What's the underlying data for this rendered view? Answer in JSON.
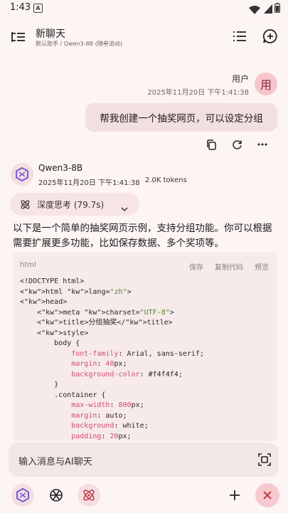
{
  "status": {
    "time": "1:43",
    "notification": "A"
  },
  "header": {
    "title": "新聊天",
    "subtitle": "默认助手 / Qwen3-8B (随叁流动)"
  },
  "user_message": {
    "name": "用户",
    "avatar": "用",
    "time": "2025年11月20日 下午1:41:38",
    "text": "帮我创建一个抽奖网页，可以设定分组"
  },
  "ai_message": {
    "name": "Qwen3-8B",
    "time": "2025年11月20日 下午1:41:38",
    "tokens": "2.0K tokens",
    "thinking": "深度思考 (79.7s)",
    "text": "以下是一个简单的抽奖网页示例，支持分组功能。你可以根据需要扩展更多功能，比如保存数据、多个奖项等。"
  },
  "code_block": {
    "lang": "html",
    "save": "保存",
    "copy": "复制代码",
    "preview": "预览",
    "lines": [
      "<!DOCTYPE html>",
      "<html lang=\"zh\">",
      "<head>",
      "    <meta charset=\"UTF-8\">",
      "    <title>分组抽奖</title>",
      "    <style>",
      "        body {",
      "            font-family: Arial, sans-serif;",
      "            margin: 40px;",
      "            background-color: #f4f4f4;",
      "        }",
      "        .container {",
      "            max-width: 800px;",
      "            margin: auto;",
      "            background: white;",
      "            padding: 20px;"
    ]
  },
  "input": {
    "placeholder": "输入消息与AI聊天"
  },
  "colors": {
    "accent": "#c43a4a",
    "background": "#fdf4f4"
  }
}
